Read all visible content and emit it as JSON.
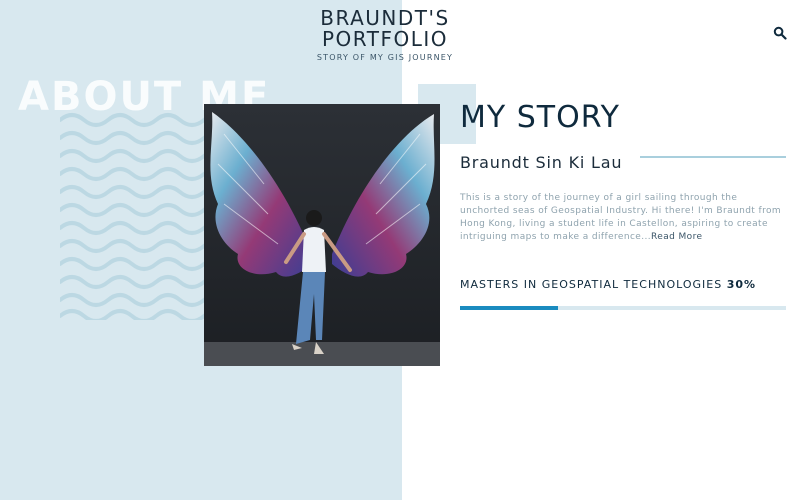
{
  "colors": {
    "panel": "#d8e8ef",
    "accent": "#1a8bbf",
    "heading": "#0f2a3d",
    "body_text": "#8fa3ae"
  },
  "header": {
    "title": "BRAUNDT'S PORTFOLIO",
    "tagline": "STORY OF MY GIS JOURNEY",
    "search_icon": "search-icon"
  },
  "about": {
    "heading": "ABOUT ME"
  },
  "story": {
    "title": "MY STORY",
    "name": "Braundt Sin Ki Lau",
    "text": "This is a story of the journey of a girl sailing through the unchorted seas of Geospatial Industry. Hi there! I'm Braundt from Hong Kong, living a student life in Castellon, aspiring to create intriguing maps to make a difference...",
    "read_more": "Read More"
  },
  "skill": {
    "label": "MASTERS IN GEOSPATIAL TECHNOLOGIES",
    "percent_text": "30%",
    "progress": 0.3
  }
}
